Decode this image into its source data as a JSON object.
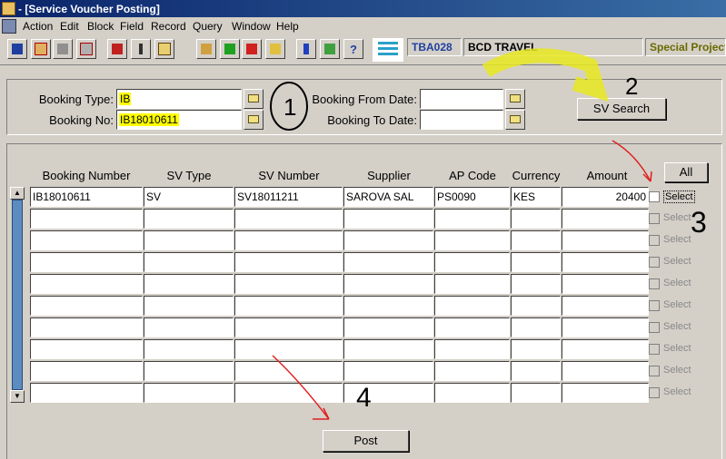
{
  "window": {
    "title": "- [Service Voucher Posting]"
  },
  "menu": [
    "Action",
    "Edit",
    "Block",
    "Field",
    "Record",
    "Query",
    "Window",
    "Help"
  ],
  "toolbar": {
    "buttons": [
      "save-icon",
      "clear-icon",
      "print-icon",
      "print-preview-icon",
      "exit-icon",
      "cursor-icon",
      "calculator-icon",
      "query-icon",
      "insert-record-icon",
      "delete-record-icon",
      "edit-icon",
      "download-icon",
      "pencil-icon",
      "help-icon"
    ],
    "help_glyph": "?",
    "code": "TBA028",
    "company": "BCD TRAVEL",
    "project": "Special Project"
  },
  "form": {
    "booking_type_label": "Booking Type:",
    "booking_type_value": "IB",
    "booking_no_label": "Booking No:",
    "booking_no_value": "IB18010611",
    "from_date_label": "Booking From Date:",
    "from_date_value": "",
    "to_date_label": "Booking To Date:",
    "to_date_value": "",
    "search_button": "SV Search"
  },
  "table": {
    "all_button": "All",
    "columns": [
      "Booking Number",
      "SV Type",
      "SV Number",
      "Supplier",
      "AP Code",
      "Currency",
      "Amount"
    ],
    "rows": [
      [
        "IB18010611",
        "SV",
        "SV18011211",
        "SAROVA SAL",
        "PS0090",
        "KES",
        "20400"
      ],
      [
        "",
        "",
        "",
        "",
        "",
        "",
        ""
      ],
      [
        "",
        "",
        "",
        "",
        "",
        "",
        ""
      ],
      [
        "",
        "",
        "",
        "",
        "",
        "",
        ""
      ],
      [
        "",
        "",
        "",
        "",
        "",
        "",
        ""
      ],
      [
        "",
        "",
        "",
        "",
        "",
        "",
        ""
      ],
      [
        "",
        "",
        "",
        "",
        "",
        "",
        ""
      ],
      [
        "",
        "",
        "",
        "",
        "",
        "",
        ""
      ],
      [
        "",
        "",
        "",
        "",
        "",
        "",
        ""
      ],
      [
        "",
        "",
        "",
        "",
        "",
        "",
        ""
      ]
    ],
    "select_label": "Select"
  },
  "post_button": "Post",
  "annotations": {
    "circle_one": "1",
    "two": "2",
    "three": "3",
    "four": "4"
  },
  "colors": {
    "highlight": "#ffff00",
    "annotation_red": "#e02020",
    "annotation_yellow": "#e8e820"
  }
}
